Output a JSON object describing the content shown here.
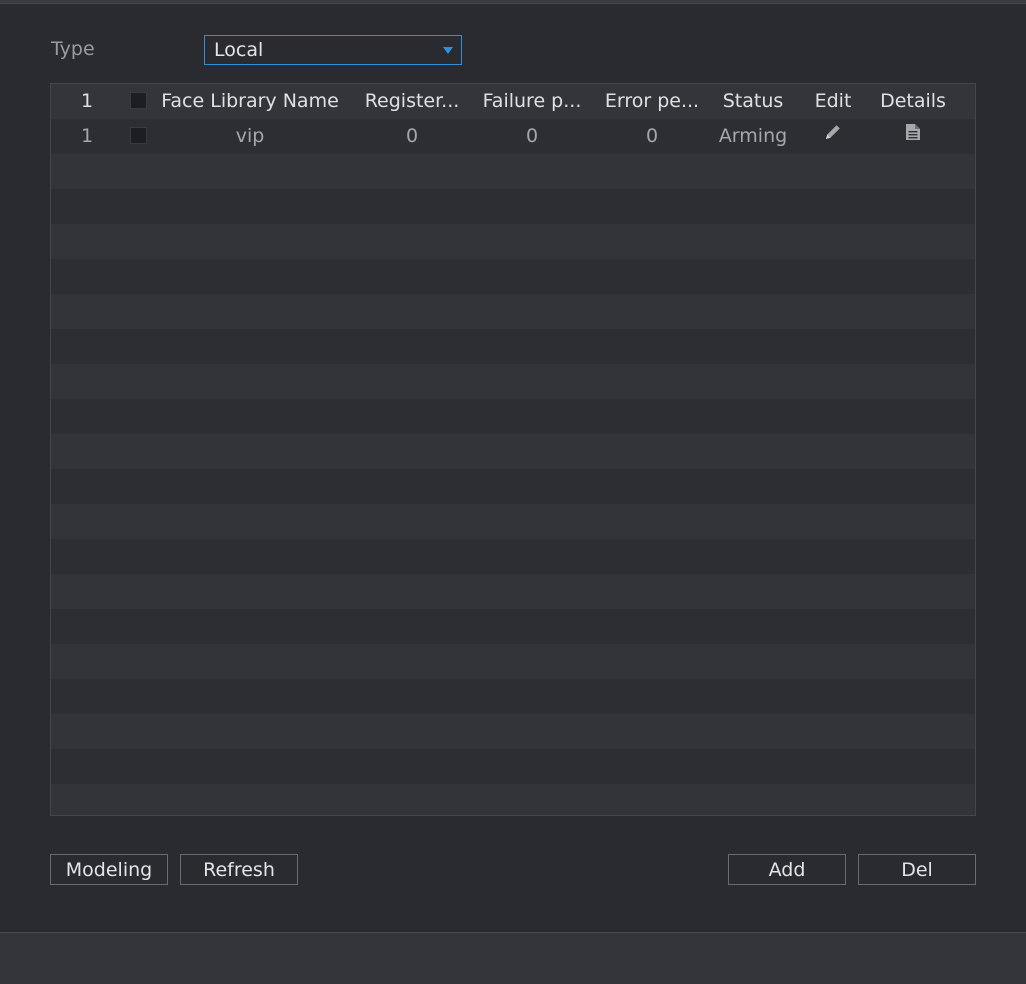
{
  "filter": {
    "type_label": "Type",
    "type_value": "Local"
  },
  "table": {
    "headers": {
      "index": "1",
      "name": "Face Library Name",
      "registered": "Register...",
      "failure": "Failure p...",
      "error": "Error pe...",
      "status": "Status",
      "edit": "Edit",
      "details": "Details"
    },
    "rows": [
      {
        "index": "1",
        "name": "vip",
        "registered": "0",
        "failure": "0",
        "error": "0",
        "status": "Arming"
      }
    ]
  },
  "buttons": {
    "modeling": "Modeling",
    "refresh": "Refresh",
    "add": "Add",
    "del": "Del"
  },
  "colors": {
    "accent": "#2f8fd8",
    "background": "#2a2b31"
  }
}
